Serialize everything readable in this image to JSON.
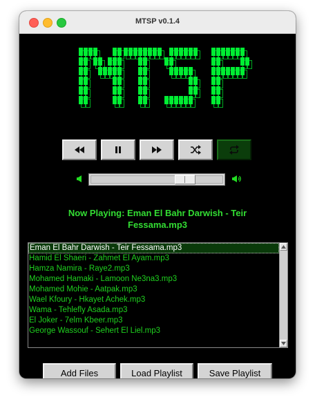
{
  "window": {
    "title": "MTSP v0.1.4"
  },
  "logo": {
    "text": "MTSP",
    "color": "#00ee33"
  },
  "controls": [
    {
      "name": "rewind-button",
      "icon": "rewind-icon"
    },
    {
      "name": "pause-button",
      "icon": "pause-icon"
    },
    {
      "name": "fast-forward-button",
      "icon": "fast-forward-icon"
    },
    {
      "name": "shuffle-button",
      "icon": "shuffle-icon"
    },
    {
      "name": "repeat-button",
      "icon": "repeat-icon",
      "active": true
    }
  ],
  "volume": {
    "level": 0.75,
    "low_icon": "volume-low-icon",
    "high_icon": "volume-high-icon"
  },
  "now_playing": {
    "line1": "Now Playing: Eman El Bahr Darwish - Teir",
    "line2": "Fessama.mp3"
  },
  "playlist": {
    "selected_index": 0,
    "tracks": [
      "Eman El Bahr Darwish - Teir Fessama.mp3",
      "Hamid El Shaeri - Zahmet El Ayam.mp3",
      "Hamza Namira - Raye2.mp3",
      "Mohamed Hamaki - Lamoon Ne3na3.mp3",
      "Mohamed Mohie - Aatpak.mp3",
      "Wael Kfoury - Hkayet Achek.mp3",
      "Wama - Tehlefly Asada.mp3",
      "El Joker - 7elm Kbeer.mp3",
      "George Wassouf - Sehert El Liel.mp3"
    ]
  },
  "buttons": {
    "add_files": "Add Files",
    "load_playlist": "Load Playlist",
    "save_playlist": "Save Playlist"
  },
  "colors": {
    "accent_green": "#33dd33",
    "track_green": "#1fd11f",
    "selected_bg": "#0a3a0a"
  }
}
